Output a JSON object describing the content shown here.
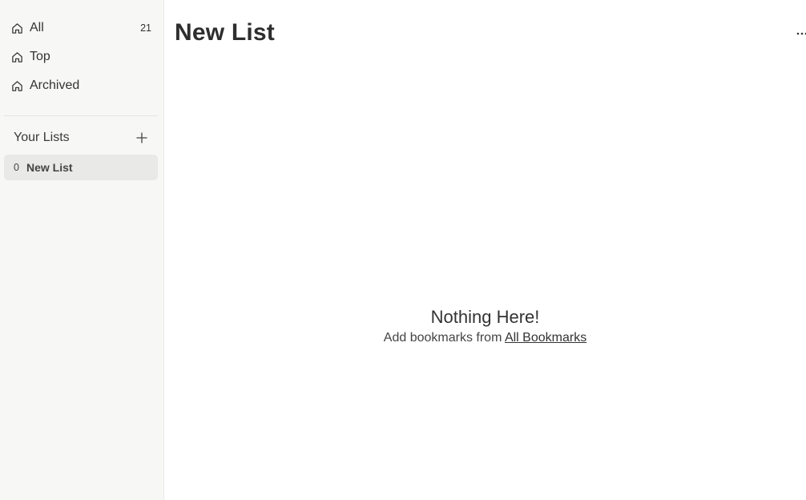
{
  "sidebar": {
    "nav": [
      {
        "label": "All",
        "count": "21",
        "icon": "home-icon"
      },
      {
        "label": "Top",
        "icon": "home-icon"
      },
      {
        "label": "Archived",
        "icon": "home-icon"
      }
    ],
    "lists_header": "Your Lists",
    "lists": [
      {
        "count": "0",
        "label": "New List"
      }
    ]
  },
  "main": {
    "title": "New List",
    "more_icon": "more-horizontal-icon",
    "empty": {
      "heading": "Nothing Here!",
      "subtext": "Add bookmarks from",
      "link": "All Bookmarks"
    }
  },
  "colors": {
    "sidebar_bg": "#f7f7f6",
    "selected_bg": "#e9e9e7",
    "text": "#2b2b2b"
  }
}
